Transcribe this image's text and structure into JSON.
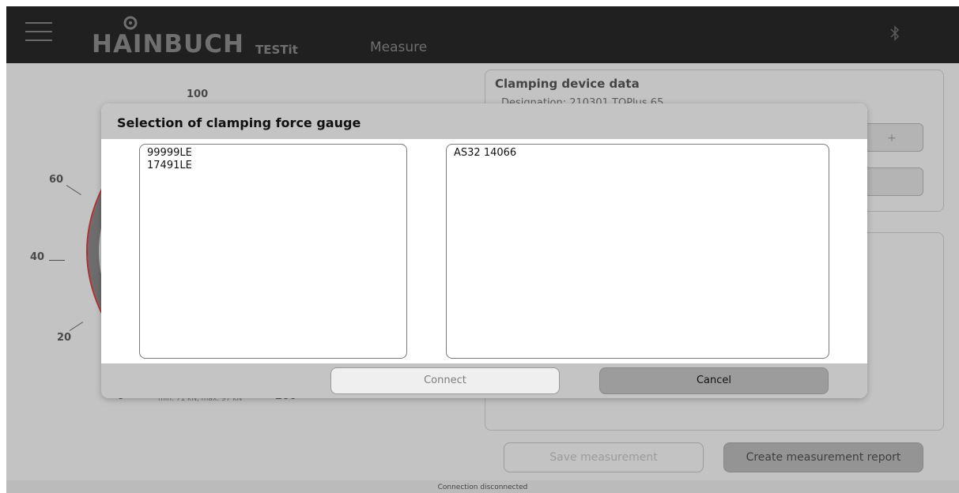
{
  "header": {
    "brand": "HAINBUCH",
    "product": "TESTit",
    "page_title": "Measure"
  },
  "gauge": {
    "tick_labels": [
      "100",
      "60",
      "40",
      "20"
    ],
    "range_note": "min. 71 kN, max. 97 kN",
    "accent_color": "#c21a1a"
  },
  "clamping_panel": {
    "title": "Clamping device data",
    "designation_line": "Designation:     210301 TOPlus 65",
    "plus_label": "+"
  },
  "actions": {
    "save_label": "Save measurement",
    "report_label": "Create measurement report"
  },
  "status": {
    "text": "Connection disconnected"
  },
  "dialog": {
    "title": "Selection of clamping force gauge",
    "left_list": [
      "99999LE",
      "17491LE"
    ],
    "right_list": [
      "AS32 14066"
    ],
    "connect_label": "Connect",
    "cancel_label": "Cancel"
  }
}
